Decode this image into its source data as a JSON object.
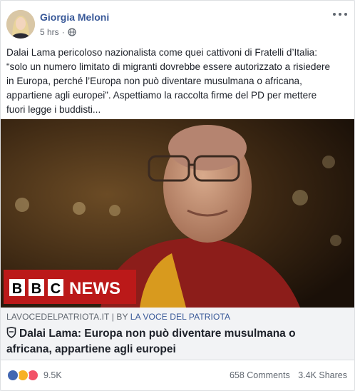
{
  "post": {
    "author": "Giorgia Meloni",
    "time": "5 hrs",
    "separator": "·",
    "privacy_icon": "globe-icon",
    "menu_icon": "more-options-icon",
    "text_lines": [
      "Dalai Lama pericoloso nazionalista come quei cattivoni di Fratelli d’Italia:",
      "“solo un numero limitato di migranti dovrebbe essere autorizzato a risiedere",
      "in Europa, perché l’Europa non può diventare musulmana o africana,",
      "appartiene agli europei”. Aspettiamo la raccolta firme del PD per mettere",
      "fuori legge i buddisti..."
    ]
  },
  "media": {
    "logo_text": [
      "B",
      "B",
      "C"
    ],
    "logo_word": "NEWS"
  },
  "link": {
    "domain": "LAVOCEDELPATRIOTA.IT",
    "divider": "|",
    "by_prefix": "BY",
    "by_name": "LA VOCE DEL PATRIOTA",
    "headline_line1": "Dalai Lama: Europa non può diventare musulmana o",
    "headline_line2": "africana, appartiene agli europei"
  },
  "footer": {
    "reaction_icons": [
      "like-icon",
      "haha-icon",
      "love-icon"
    ],
    "reaction_count": "9.5K",
    "comments": "658 Comments",
    "shares": "3.4K Shares"
  },
  "colors": {
    "link_blue": "#385898",
    "text": "#1d2129",
    "muted": "#606770",
    "bbc_red": "#bb1919"
  }
}
